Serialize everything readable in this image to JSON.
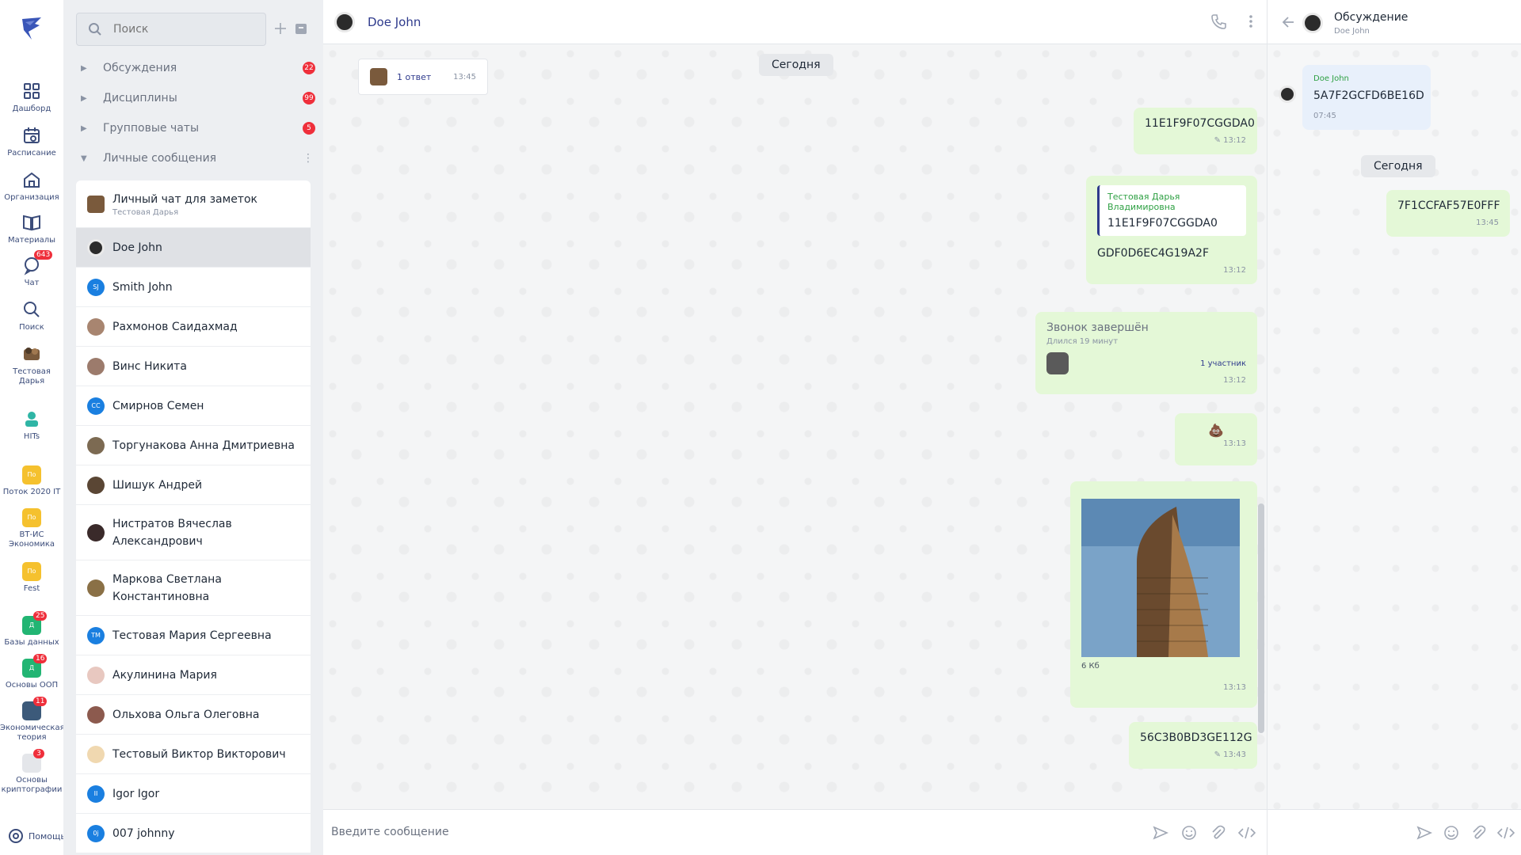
{
  "colors": {
    "accent": "#2e3a8c",
    "badge": "#ef2f3b",
    "bubble": "#e4f8d7",
    "quote_author": "#2ea043"
  },
  "rail": {
    "items": [
      {
        "label": "Дашборд",
        "icon": "grid-icon"
      },
      {
        "label": "Расписание",
        "icon": "calendar-icon"
      },
      {
        "label": "Организация",
        "icon": "home-icon"
      },
      {
        "label": "Материалы",
        "icon": "book-icon"
      },
      {
        "label": "Чат",
        "icon": "chat-icon",
        "badge": "643"
      },
      {
        "label": "Поиск",
        "icon": "search-icon"
      },
      {
        "label": "Тестовая Дарья",
        "icon": "avatar"
      }
    ],
    "groups": [
      {
        "label": "HITs",
        "chip": ""
      },
      {
        "label": "Поток 2020 IT",
        "chip": "По"
      },
      {
        "label": "ВТ-ИС Экономика",
        "chip": "По"
      },
      {
        "label": "Fest",
        "chip": "По"
      },
      {
        "label": "Базы данных",
        "chip": "Д",
        "badge": "25"
      },
      {
        "label": "Основы ООП",
        "chip": "Д",
        "badge": "16"
      },
      {
        "label": "Экономическая теория",
        "chip": "",
        "badge": "11"
      },
      {
        "label": "Основы криптографии",
        "chip": "",
        "badge": "3"
      }
    ],
    "help": "Помощь"
  },
  "list": {
    "search_placeholder": "Поиск",
    "sections": [
      {
        "label": "Обсуждения",
        "badge": "22"
      },
      {
        "label": "Дисциплины",
        "badge": "99"
      },
      {
        "label": "Групповые чаты",
        "badge": "5"
      },
      {
        "label": "Личные сообщения",
        "badge": ""
      }
    ],
    "contacts": [
      {
        "name": "Личный чат для заметок",
        "sub": "Тестовая Дарья"
      },
      {
        "name": "Doe John",
        "sub": ""
      },
      {
        "name": "Smith John",
        "initials": "SJ"
      },
      {
        "name": "Рахмонов Саидахмад"
      },
      {
        "name": "Винс Никита"
      },
      {
        "name": "Смирнов Семен",
        "initials": "СС"
      },
      {
        "name": "Торгунакова Анна Дмитриевна"
      },
      {
        "name": "Шишук Андрей"
      },
      {
        "name": "Нистратов Вячеслав Александрович"
      },
      {
        "name": "Маркова Светлана Константиновна"
      },
      {
        "name": "Тестовая Мария Сергеевна",
        "initials": "ТМ"
      },
      {
        "name": "Акулинина Мария"
      },
      {
        "name": "Ольхова Ольга Олеговна"
      },
      {
        "name": "Тестовый Виктор Викторович"
      },
      {
        "name": "Igor Igor",
        "initials": "II"
      },
      {
        "name": "007 johnny",
        "initials": "0j"
      }
    ]
  },
  "chat": {
    "title": "Doe John",
    "reply_card": {
      "text": "1 ответ",
      "time": "13:45"
    },
    "date_chip": "Сегодня",
    "messages": [
      {
        "text": "11E1F9F07CGGDA0",
        "time": "13:12"
      },
      {
        "quote_author": "Тестовая Дарья Владимировна",
        "quote_text": "11E1F9F07CGGDA0",
        "text": "GDF0D6EC4G19A2F",
        "time": "13:12"
      },
      {
        "title": "Звонок завершён",
        "duration": "Длился 19 минут",
        "participants": "1 участник",
        "time": "13:12"
      },
      {
        "emoji": "💩",
        "time": "13:13"
      },
      {
        "image_caption": "6 Кб",
        "time": "13:13"
      },
      {
        "text": "56C3B0BD3GE112G",
        "time": "13:43"
      }
    ],
    "composer_placeholder": "Введите сообщение"
  },
  "thread": {
    "title": "Обсуждение",
    "subtitle": "Doe John",
    "root": {
      "author": "Doe John",
      "text": "5A7F2GCFD6BE16D",
      "time": "07:45"
    },
    "date_chip": "Сегодня",
    "reply": {
      "text": "7F1CCFAF57E0FFF",
      "time": "13:45"
    }
  }
}
